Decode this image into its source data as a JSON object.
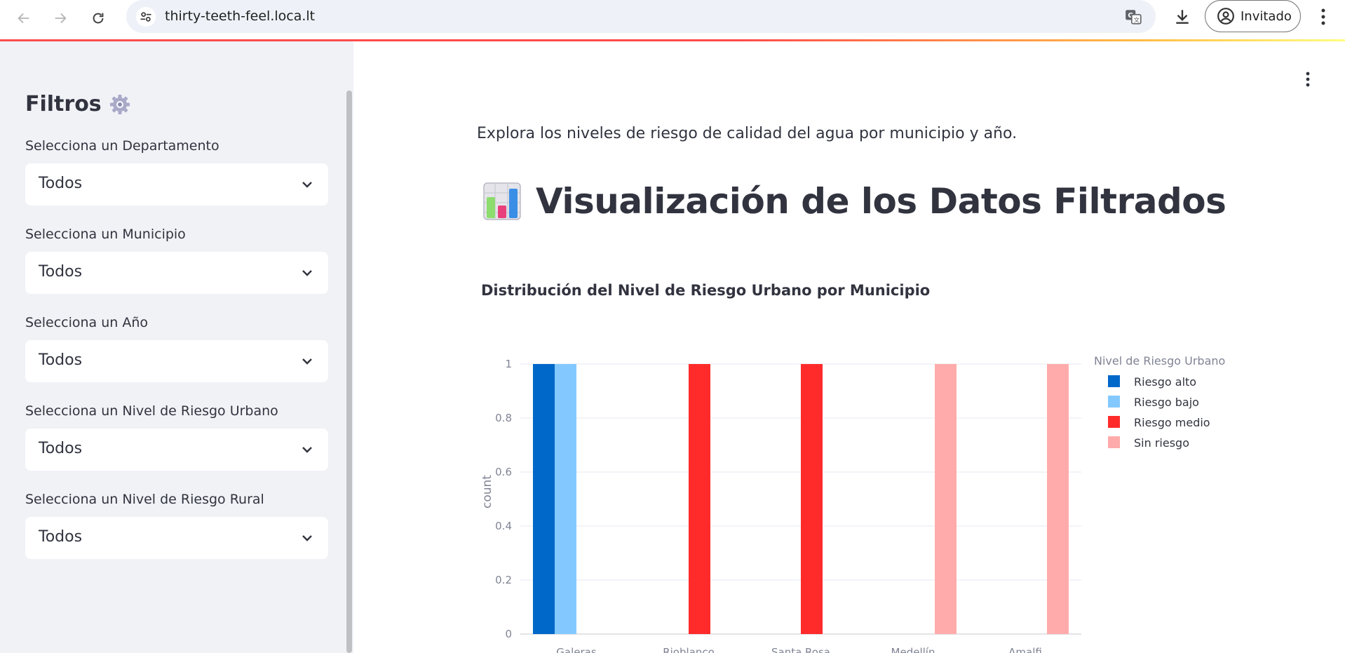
{
  "browser": {
    "url": "thirty-teeth-feel.loca.lt",
    "profile_label": "Invitado"
  },
  "sidebar": {
    "title": "Filtros",
    "title_icon": "gear-icon",
    "filters": [
      {
        "label": "Selecciona un Departamento",
        "value": "Todos"
      },
      {
        "label": "Selecciona un Municipio",
        "value": "Todos"
      },
      {
        "label": "Selecciona un Año",
        "value": "Todos"
      },
      {
        "label": "Selecciona un Nivel de Riesgo Urbano",
        "value": "Todos"
      },
      {
        "label": "Selecciona un Nivel de Riesgo Rural",
        "value": "Todos"
      }
    ]
  },
  "main": {
    "intro": "Explora los niveles de riesgo de calidad del agua por municipio y año.",
    "heading": "Visualización de los Datos Filtrados",
    "heading_icon": "bar-chart-icon"
  },
  "chart_data": {
    "type": "bar",
    "title": "Distribución del Nivel de Riesgo Urbano por Municipio",
    "xlabel": "",
    "ylabel": "count",
    "ylim": [
      0,
      1
    ],
    "yticks": [
      "0",
      "0.2",
      "0.4",
      "0.6",
      "0.8",
      "1"
    ],
    "categories": [
      "Galeras",
      "Rioblanco",
      "Santa Rosa",
      "Medellín",
      "Amalfi"
    ],
    "legend_title": "Nivel de Riesgo Urbano",
    "legend_position": "right",
    "grid": true,
    "barmode": "group",
    "series": [
      {
        "name": "Riesgo alto",
        "color": "#0068c9",
        "values": [
          1,
          0,
          0,
          0,
          0
        ]
      },
      {
        "name": "Riesgo bajo",
        "color": "#83c9ff",
        "values": [
          1,
          0,
          0,
          0,
          0
        ]
      },
      {
        "name": "Riesgo medio",
        "color": "#ff2b2b",
        "values": [
          0,
          1,
          1,
          0,
          0
        ]
      },
      {
        "name": "Sin riesgo",
        "color": "#ffabab",
        "values": [
          0,
          0,
          0,
          1,
          1
        ]
      }
    ]
  }
}
